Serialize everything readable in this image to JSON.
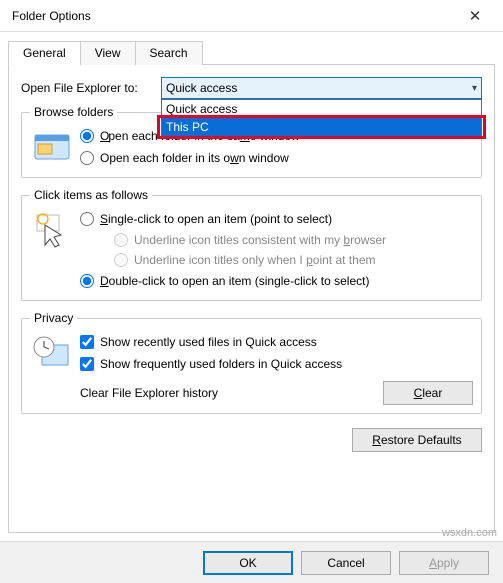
{
  "window": {
    "title": "Folder Options"
  },
  "tabs": {
    "general": "General",
    "view": "View",
    "search": "Search"
  },
  "open_explorer": {
    "label": "Open File Explorer to:",
    "selected": "Quick access",
    "options": [
      "Quick access",
      "This PC"
    ]
  },
  "browse": {
    "legend": "Browse folders",
    "same": "Open each folder in the same window",
    "own": "Open each folder in its own window"
  },
  "click_items": {
    "legend": "Click items as follows",
    "single": "Single-click to open an item (point to select)",
    "underline_browser": "Underline icon titles consistent with my browser",
    "underline_point": "Underline icon titles only when I point at them",
    "double": "Double-click to open an item (single-click to select)"
  },
  "privacy": {
    "legend": "Privacy",
    "recent_files": "Show recently used files in Quick access",
    "freq_folders": "Show frequently used folders in Quick access",
    "clear_label": "Clear File Explorer history",
    "clear_btn": "Clear"
  },
  "restore": "Restore Defaults",
  "footer": {
    "ok": "OK",
    "cancel": "Cancel",
    "apply": "Apply"
  },
  "watermark": "wsxdn.com"
}
